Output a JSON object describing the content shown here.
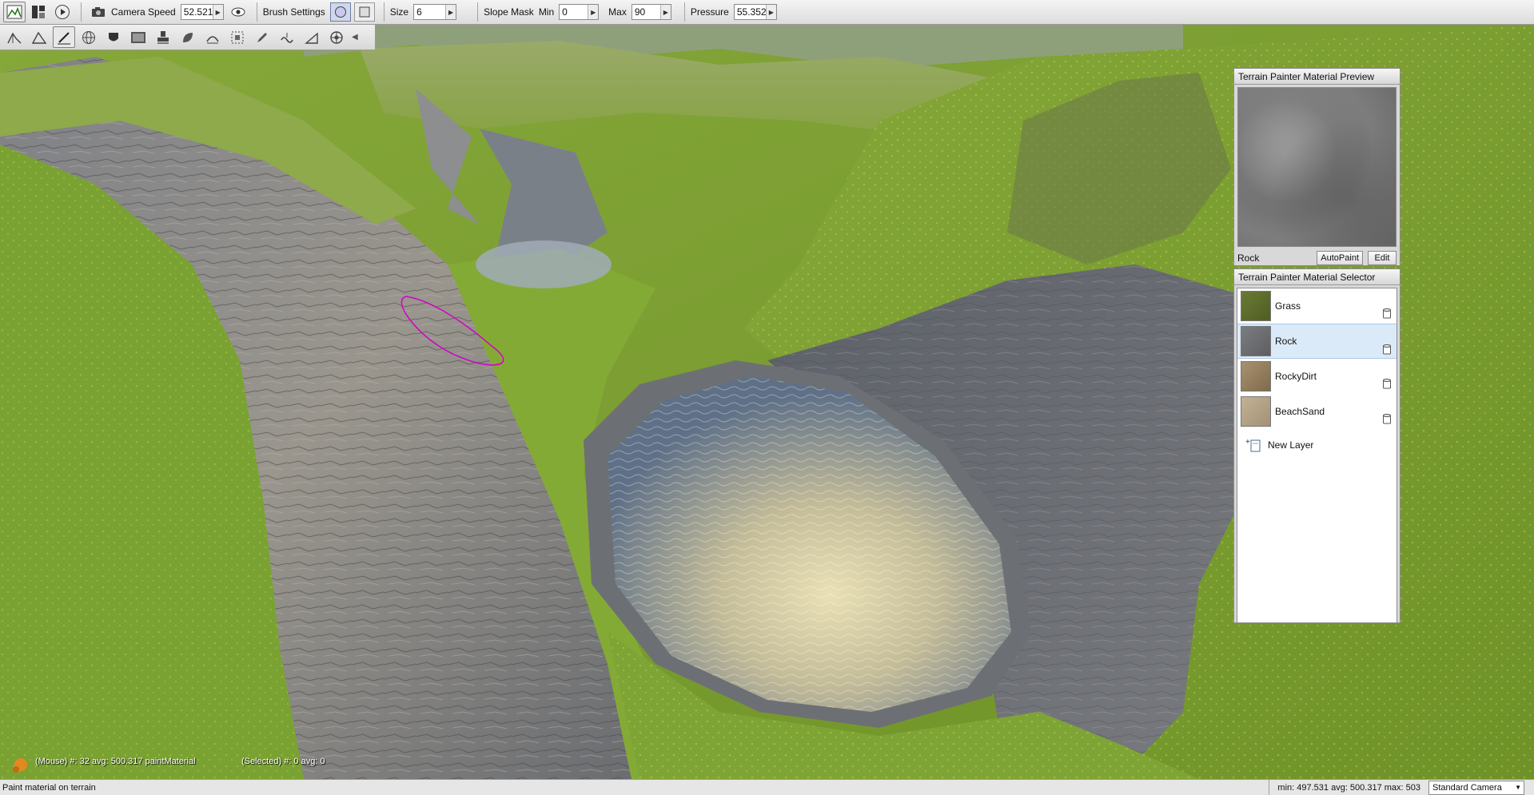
{
  "toolbar": {
    "camera_speed_label": "Camera Speed",
    "camera_speed_value": "52.521",
    "brush_settings_label": "Brush Settings",
    "size_label": "Size",
    "size_value": "6",
    "slope_mask_label": "Slope Mask",
    "min_label": "Min",
    "min_value": "0",
    "max_label": "Max",
    "max_value": "90",
    "pressure_label": "Pressure",
    "pressure_value": "55.352"
  },
  "preview_panel": {
    "title": "Terrain Painter Material Preview",
    "material_name": "Rock",
    "autopaint_label": "AutoPaint",
    "edit_label": "Edit"
  },
  "selector_panel": {
    "title": "Terrain Painter Material Selector",
    "materials": [
      {
        "name": "Grass",
        "color": "#5e6e2c"
      },
      {
        "name": "Rock",
        "color": "#6e6f72"
      },
      {
        "name": "RockyDirt",
        "color": "#9a8562"
      },
      {
        "name": "BeachSand",
        "color": "#b6a58a"
      }
    ],
    "new_layer_label": "New Layer"
  },
  "viewport": {
    "mouse_info": "(Mouse) #: 32  avg: 500.317 paintMaterial",
    "selected_info": "(Selected) #: 0  avg: 0"
  },
  "statusbar": {
    "message": "Paint material on terrain",
    "stats": "min: 497.531  avg: 500.317  max: 503",
    "camera": "Standard Camera"
  },
  "colors": {
    "selection_highlight": "#dbeaf8",
    "brush_cursor": "#d400c8"
  }
}
